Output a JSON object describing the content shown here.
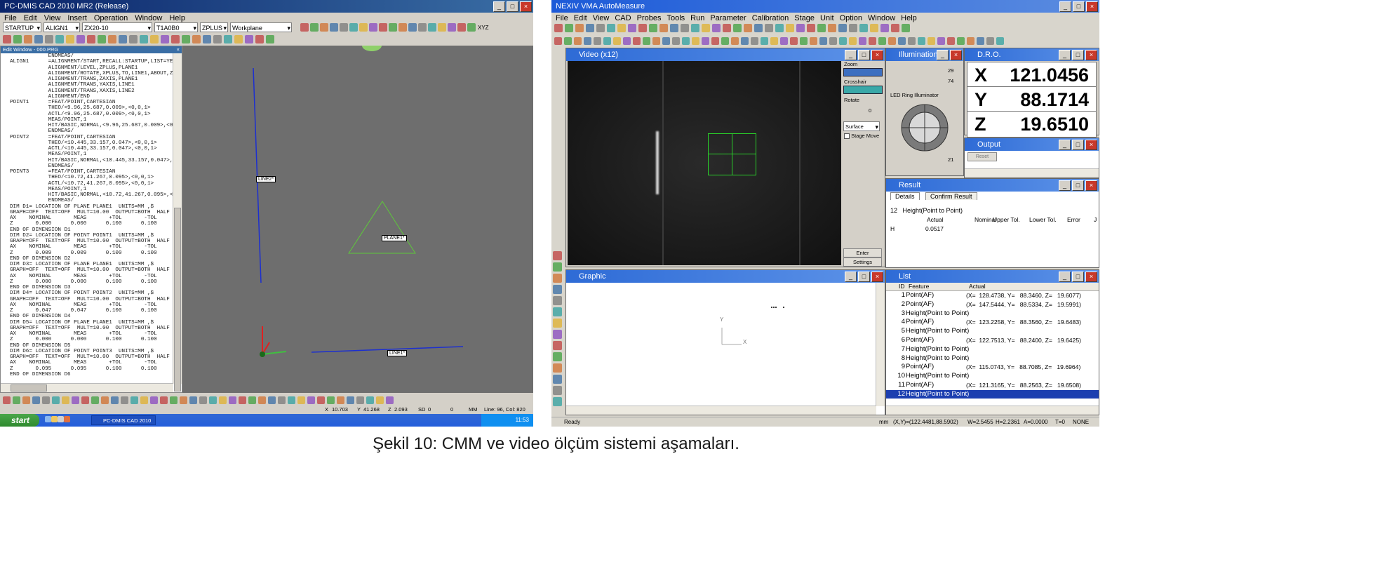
{
  "left": {
    "title": "PC-DMIS CAD 2010 MR2 (Release)",
    "menu": [
      "File",
      "Edit",
      "View",
      "Insert",
      "Operation",
      "Window",
      "Help"
    ],
    "combos": [
      "STARTUP",
      "ALIGN1",
      "ZX20-10",
      "T1A0B0",
      "ZPLUS",
      "Workplane"
    ],
    "xyz_btn": "XYZ",
    "edit_title": "Edit Window - 000.PRG",
    "code_lines": [
      "            ENDMEAS/",
      "ALIGN1      =ALIGNMENT/START,RECALL:STARTUP,LIST=YES",
      "            ALIGNMENT/LEVEL,ZPLUS,PLANE1",
      "            ALIGNMENT/ROTATE,XPLUS,TO,LINE1,ABOUT,ZPLUS",
      "            ALIGNMENT/TRANS,ZAXIS,PLANE1",
      "            ALIGNMENT/TRANS,YAXIS,LINE1",
      "            ALIGNMENT/TRANS,XAXIS,LINE2",
      "            ALIGNMENT/END",
      "POINT1      =FEAT/POINT,CARTESIAN",
      "            THEO/<9.96,25.687,0.009>,<0,0,1>",
      "            ACTL/<9.96,25.687,0.009>,<0,0,1>",
      "            MEAS/POINT,1",
      "            HIT/BASIC,NORMAL,<9.96,25.687,0.009>,<0,0,1>",
      "            ENDMEAS/",
      "POINT2      =FEAT/POINT,CARTESIAN",
      "            THEO/<10.445,33.157,0.047>,<0,0,1>",
      "            ACTL/<10.445,33.157,0.047>,<0,0,1>",
      "            MEAS/POINT,1",
      "            HIT/BASIC,NORMAL,<10.445,33.157,0.047>,<0,0,",
      "            ENDMEAS/",
      "POINT3      =FEAT/POINT,CARTESIAN",
      "            THEO/<10.72,41.267,0.095>,<0,0,1>",
      "            ACTL/<10.72,41.267,0.095>,<0,0,1>",
      "            MEAS/POINT,1",
      "            HIT/BASIC,NORMAL,<10.72,41.267,0.095>,<0,0,1>",
      "            ENDMEAS/",
      "DIM D1= LOCATION OF PLANE PLANE1  UNITS=MM ,$",
      "GRAPH=OFF  TEXT=OFF  MULT=10.00  OUTPUT=BOTH  HALF ANGLE",
      "AX    NOMINAL       MEAS       +TOL       -TOL       DE",
      "Z       0.000      0.000      0.100      0.100      0.0",
      "END OF DIMENSION D1",
      "DIM D2= LOCATION OF POINT POINT1  UNITS=MM ,$",
      "GRAPH=OFF  TEXT=OFF  MULT=10.00  OUTPUT=BOTH  HALF ANGLE",
      "AX    NOMINAL       MEAS       +TOL       -TOL       DE",
      "Z       0.009      0.009      0.100      0.100      0.0",
      "END OF DIMENSION D2",
      "DIM D3= LOCATION OF PLANE PLANE1  UNITS=MM ,$",
      "GRAPH=OFF  TEXT=OFF  MULT=10.00  OUTPUT=BOTH  HALF ANGLE",
      "AX    NOMINAL       MEAS       +TOL       -TOL       DE",
      "Z       0.000      0.000      0.100      0.100      0.0",
      "END OF DIMENSION D3",
      "DIM D4= LOCATION OF POINT POINT2  UNITS=MM ,$",
      "GRAPH=OFF  TEXT=OFF  MULT=10.00  OUTPUT=BOTH  HALF ANGLE",
      "AX    NOMINAL       MEAS       +TOL       -TOL       DE",
      "Z       0.047      0.047      0.100      0.100      0.0",
      "END OF DIMENSION D4",
      "DIM D5= LOCATION OF PLANE PLANE1  UNITS=MM ,$",
      "GRAPH=OFF  TEXT=OFF  MULT=10.00  OUTPUT=BOTH  HALF ANGLE",
      "AX    NOMINAL       MEAS       +TOL       -TOL       DE",
      "Z       0.000      0.000      0.100      0.100      0.0",
      "END OF DIMENSION D5",
      "DIM D6= LOCATION OF POINT POINT3  UNITS=MM ,$",
      "GRAPH=OFF  TEXT=OFF  MULT=10.00  OUTPUT=BOTH  HALF ANGLE",
      "AX    NOMINAL       MEAS       +TOL       -TOL       DE",
      "Z       0.095      0.095      0.100      0.100      0.0",
      "END OF DIMENSION D6"
    ],
    "cad_labels": {
      "line2": "LINE2*",
      "plane1": "PLANE1*",
      "line1": "LINE1*"
    },
    "status": {
      "x_label": "X",
      "x": "10.703",
      "y_label": "Y",
      "y": "41.268",
      "z_label": "Z",
      "z": "2.093",
      "sd_label": "SD",
      "sd": "0",
      "zero": "0",
      "unit": "MM",
      "line": "Line: 96, Col: 820"
    },
    "taskbar": {
      "start": "start",
      "task": "PC-DMIS CAD 2010 M...",
      "time": "11:53"
    }
  },
  "right": {
    "title": "NEXIV VMA AutoMeasure",
    "menu": [
      "File",
      "Edit",
      "View",
      "CAD",
      "Probes",
      "Tools",
      "Run",
      "Parameter",
      "Calibration",
      "Stage",
      "Unit",
      "Option",
      "Window",
      "Help"
    ],
    "video_title": "Video (x12)",
    "video_ctrl": {
      "zoom": "Zoom",
      "crosshair": "Crosshair",
      "rotate": "Rotate",
      "rotate_val": "0",
      "surface": "Surface",
      "stage_move": "Stage Move",
      "enter": "Enter",
      "settings": "Settings"
    },
    "illum": {
      "title": "Illumination",
      "v1": "29",
      "v2": "74",
      "ring": "LED Ring Illuminator",
      "v3": "21"
    },
    "dro": {
      "title": "D.R.O.",
      "rows": [
        {
          "axis": "X",
          "value": "121.0456"
        },
        {
          "axis": "Y",
          "value": "88.1714"
        },
        {
          "axis": "Z",
          "value": "19.6510"
        }
      ]
    },
    "output": {
      "title": "Output",
      "btn": "Reset"
    },
    "result": {
      "title": "Result",
      "tabs": [
        "Details",
        "Confirm Result"
      ],
      "row_label": "12   Height(Point to Point)",
      "cols": [
        "Actual",
        "Nominal",
        "Upper Tol.",
        "Lower Tol.",
        "Error",
        "J"
      ],
      "axis": "H",
      "actual": "0.0517"
    },
    "graphic": {
      "title": "Graphic",
      "y": "Y",
      "x": "X"
    },
    "list": {
      "title": "List",
      "cols": [
        "ID",
        "Feature",
        "Actual"
      ],
      "rows": [
        {
          "id": "1",
          "feature": "Point(AF)",
          "actual": "(X=  128.4738, Y=   88.3460, Z=   19.6077)"
        },
        {
          "id": "2",
          "feature": "Point(AF)",
          "actual": "(X=  147.5444, Y=   88.5334, Z=   19.5991)"
        },
        {
          "id": "3",
          "feature": "Height(Point to Point)",
          "actual": ""
        },
        {
          "id": "4",
          "feature": "Point(AF)",
          "actual": "(X=  123.2258, Y=   88.3560, Z=   19.6483)"
        },
        {
          "id": "5",
          "feature": "Height(Point to Point)",
          "actual": ""
        },
        {
          "id": "6",
          "feature": "Point(AF)",
          "actual": "(X=  122.7513, Y=   88.2400, Z=   19.6425)"
        },
        {
          "id": "7",
          "feature": "Height(Point to Point)",
          "actual": ""
        },
        {
          "id": "8",
          "feature": "Height(Point to Point)",
          "actual": ""
        },
        {
          "id": "9",
          "feature": "Point(AF)",
          "actual": "(X=  115.0743, Y=   88.7085, Z=   19.6964)"
        },
        {
          "id": "10",
          "feature": "Height(Point to Point)",
          "actual": ""
        },
        {
          "id": "11",
          "feature": "Point(AF)",
          "actual": "(X=  121.3165, Y=   88.2563, Z=   19.6508)"
        },
        {
          "id": "12",
          "feature": "Height(Point to Point)",
          "actual": ""
        }
      ]
    },
    "status": {
      "ready": "Ready",
      "mm": "mm",
      "xy": "(X,Y)=(122.4481,88.5902)",
      "w": "W=2.5455",
      "h": "H=2.2361",
      "a": "A=0.0000",
      "t": "T=0",
      "none": "NONE"
    }
  },
  "caption": "Şekil 10: CMM ve video ölçüm sistemi aşamaları."
}
